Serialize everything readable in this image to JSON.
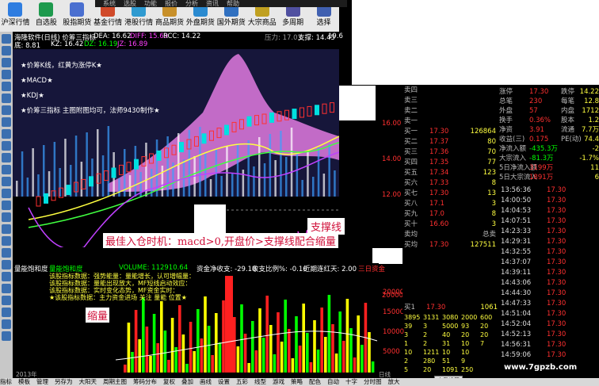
{
  "toolbar": {
    "items": [
      {
        "label": "沪深行情",
        "icon": "chart-icon"
      },
      {
        "label": "自选股",
        "icon": "dollar-icon"
      },
      {
        "label": "股指期货",
        "icon": "magnify-icon"
      },
      {
        "label": "基金行情",
        "icon": "chart-icon"
      },
      {
        "label": "港股行情",
        "icon": "dollar-icon"
      },
      {
        "label": "商品期货",
        "icon": "cart-icon"
      },
      {
        "label": "外盘期货",
        "icon": "globe-icon"
      },
      {
        "label": "国外期货",
        "icon": "chart-icon"
      },
      {
        "label": "大宗商品",
        "icon": "coins-icon"
      },
      {
        "label": "多周期",
        "icon": "grid-icon"
      },
      {
        "label": "选择",
        "icon": "grid-icon"
      }
    ],
    "menu": [
      "系统",
      "选股",
      "功能",
      "报价",
      "分析",
      "资讯",
      "帮助"
    ]
  },
  "chart_header": {
    "title": "海隆软件(日线) 价筹三指标",
    "dea": "DEA: 16.62",
    "diff": "DIFF: 15.69",
    "rcc": "RCC: 14.22",
    "pressure": "压力: 17.03",
    "support": "支撑: 14.45",
    "line2_left": "底: 8.81",
    "kz": "KZ: 16.42",
    "dz": "DZ: 16.19",
    "jz": "JZ: 16.89",
    "right_val": "19.6"
  },
  "legend": [
    "★价筹K线，红黄为涨停K★",
    "★MACD★",
    "★KDJ★",
    "★价筹三指标 主图附图均可，法师9430制作★"
  ],
  "price_axis": [
    "16.00",
    "14.00",
    "12.00"
  ],
  "annotations": {
    "entry": "最佳入仓时机：macd>0,开盘价>支撑线配合缩量",
    "support_line": "支撑线",
    "shrink": "缩量"
  },
  "volume_header": {
    "title": "量能饱和度",
    "name": "量能饱和度",
    "volume": "VOLUME: 112910.64",
    "capital": "资金净收支: -29.16",
    "ratio": "收支比例%: -0.16",
    "red_days": "近期连红天: 2.00",
    "hold": "三日资金"
  },
  "volume_notes": [
    "该股指标数据：强势能量：量能增长，认可增幅量：",
    "该股指标数据：量能出现放大，MF短线启动效应：",
    "该股指标数据：实时变化态势，MF资金实时：",
    "★该股指标数据：主力资金进场 关注 量能 位置★"
  ],
  "vol_axis": [
    "20000",
    "15000",
    "10000",
    "5000"
  ],
  "vol_date": "2013年",
  "vol_label_right": "日线",
  "mini_tabs": [
    "指标",
    "模板",
    "管理",
    "另存为",
    "大阳天"
  ],
  "orderbook": {
    "sells": [
      {
        "label": "卖四",
        "price": "",
        "vol": ""
      },
      {
        "label": "卖三",
        "price": "",
        "vol": ""
      },
      {
        "label": "卖二",
        "price": "",
        "vol": ""
      },
      {
        "label": "卖一",
        "price": "",
        "vol": ""
      }
    ],
    "buys": [
      {
        "label": "买一",
        "price": "17.30",
        "vol": "126864"
      },
      {
        "label": "买二",
        "price": "17.37",
        "vol": "80"
      },
      {
        "label": "买三",
        "price": "17.36",
        "vol": "70"
      },
      {
        "label": "买四",
        "price": "17.35",
        "vol": "77"
      },
      {
        "label": "买五",
        "price": "17.34",
        "vol": "123"
      },
      {
        "label": "买六",
        "price": "17.33",
        "vol": "8"
      },
      {
        "label": "买七",
        "price": "17.30",
        "vol": "13"
      },
      {
        "label": "买八",
        "price": "17.1",
        "vol": "3"
      },
      {
        "label": "买九",
        "price": "17.0",
        "vol": "8"
      },
      {
        "label": "买十",
        "price": "16.60",
        "vol": "3"
      }
    ],
    "sell_avg_label": "卖均",
    "sell_total_label": "总卖",
    "buy_avg_label": "买均",
    "buy_avg": "17.30",
    "buy_total_label": "总买",
    "buy_total": "127511"
  },
  "quote_stats": [
    {
      "a": "涨停",
      "b": "17.30",
      "c": "跌停",
      "d": "14.22"
    },
    {
      "a": "总笔",
      "b": "230",
      "c": "每笔",
      "d": "12.8"
    },
    {
      "a": "外盘",
      "b": "57",
      "c": "内盘",
      "d": "1712"
    },
    {
      "a": "换手",
      "b": "0.36%",
      "c": "股本",
      "d": "1.2"
    },
    {
      "a": "净资",
      "b": "3.91",
      "c": "流通",
      "d": "7.7万"
    },
    {
      "a": "收益(三)",
      "b": "0.175",
      "c": "PE(动)",
      "d": "74.4"
    },
    {
      "a": "净流入额",
      "b": "-435.3万",
      "c": "",
      "d": "-2"
    },
    {
      "a": "大宗流入",
      "b": "-81.3万",
      "c": "",
      "d": "-1.7%"
    },
    {
      "a": "5日净流入额",
      "b": "3199万",
      "c": "",
      "d": "11"
    },
    {
      "a": "5日大宗流入",
      "b": "1891万",
      "c": "",
      "d": "6"
    }
  ],
  "trades": [
    {
      "time": "13:56:36",
      "price": "17.30"
    },
    {
      "time": "14:00:50",
      "price": "17.30"
    },
    {
      "time": "14:04:53",
      "price": "17.30"
    },
    {
      "time": "14:07:51",
      "price": "17.30"
    },
    {
      "time": "14:23:33",
      "price": "17.30"
    },
    {
      "time": "14:29:31",
      "price": "17.30"
    },
    {
      "time": "14:32:55",
      "price": "17.30"
    },
    {
      "time": "14:37:07",
      "price": "17.30"
    },
    {
      "time": "14:39:11",
      "price": "17.30"
    },
    {
      "time": "14:43:06",
      "price": "17.30"
    },
    {
      "time": "14:44:30",
      "price": "17.30"
    },
    {
      "time": "14:47:33",
      "price": "17.30"
    },
    {
      "time": "14:51:04",
      "price": "17.30"
    },
    {
      "time": "14:52:04",
      "price": "17.30"
    },
    {
      "time": "14:52:13",
      "price": "17.30"
    },
    {
      "time": "14:56:31",
      "price": "17.30"
    },
    {
      "time": "14:59:06",
      "price": "17.30"
    }
  ],
  "queue": {
    "header": "买1",
    "header_price": "17.30",
    "header_vol": "1061",
    "rows": [
      [
        "3895",
        "3131",
        "3080",
        "2000",
        "600"
      ],
      [
        "39",
        "3",
        "5000",
        "93",
        "20"
      ],
      [
        "3",
        "2",
        "40",
        "20",
        "20"
      ],
      [
        "1",
        "2",
        "31",
        "10",
        "7"
      ],
      [
        "10",
        "1211",
        "10",
        "10",
        ""
      ],
      [
        "2",
        "280",
        "51",
        "9",
        ""
      ],
      [
        "5",
        "20",
        "1091",
        "250",
        ""
      ]
    ]
  },
  "watermark": "www.7gpzb.com",
  "click_setup": "点我设置",
  "bottombar": [
    "指标",
    "模板",
    "管理",
    "另存为",
    "大阳天",
    "周期主图",
    "筹码分布",
    "复权",
    "叠加",
    "画线",
    "设置",
    "五彩",
    "线型",
    "游戏",
    "策略",
    "配色",
    "自动",
    "十字",
    "分时图",
    "放大"
  ],
  "colors": {
    "up": "#ff3030",
    "down": "#00e0e0",
    "bg": "#000000",
    "vol_red": "#ff2020",
    "vol_yellow": "#ffff00",
    "vol_green": "#00ff00",
    "cloud": "#ff80ff"
  }
}
